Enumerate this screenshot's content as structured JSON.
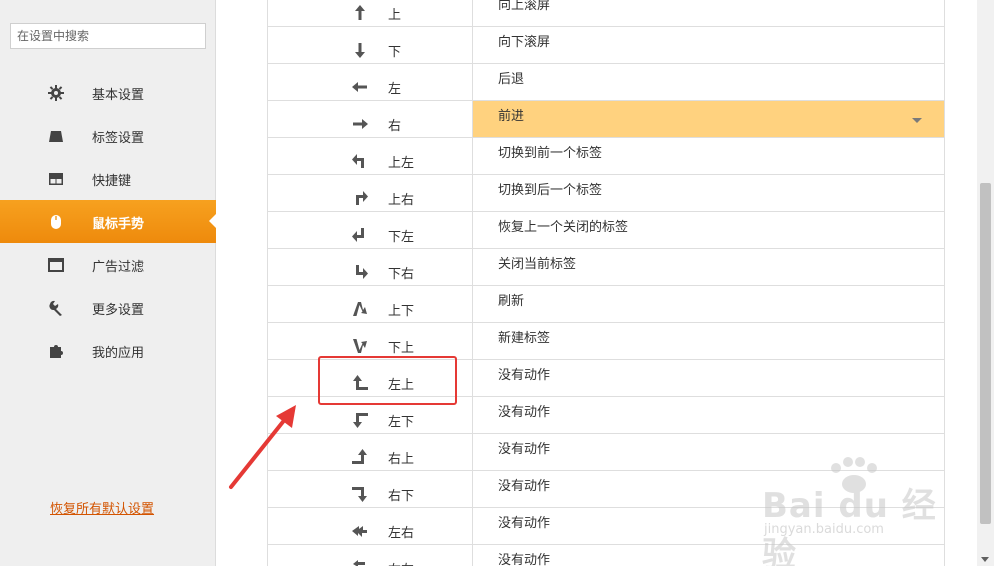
{
  "sidebar": {
    "search_placeholder": "在设置中搜索",
    "items": [
      {
        "label": "基本设置",
        "icon": "gear-icon"
      },
      {
        "label": "标签设置",
        "icon": "tab-icon"
      },
      {
        "label": "快捷键",
        "icon": "keyboard-icon"
      },
      {
        "label": "鼠标手势",
        "icon": "mouse-icon",
        "active": true
      },
      {
        "label": "广告过滤",
        "icon": "window-icon"
      },
      {
        "label": "更多设置",
        "icon": "wrench-icon"
      },
      {
        "label": "我的应用",
        "icon": "puzzle-icon"
      }
    ],
    "restore_label": "恢复所有默认设置"
  },
  "gestures": [
    {
      "label": "上",
      "icon": "arrow-up-icon",
      "action": "向上滚屏"
    },
    {
      "label": "下",
      "icon": "arrow-down-icon",
      "action": "向下滚屏"
    },
    {
      "label": "左",
      "icon": "arrow-left-icon",
      "action": "后退"
    },
    {
      "label": "右",
      "icon": "arrow-right-icon",
      "action": "前进",
      "selected": true
    },
    {
      "label": "上左",
      "icon": "up-left-icon",
      "action": "切换到前一个标签"
    },
    {
      "label": "上右",
      "icon": "up-right-icon",
      "action": "切换到后一个标签"
    },
    {
      "label": "下左",
      "icon": "down-left-icon",
      "action": "恢复上一个关闭的标签"
    },
    {
      "label": "下右",
      "icon": "down-right-icon",
      "action": "关闭当前标签"
    },
    {
      "label": "上下",
      "icon": "up-down-icon",
      "action": "刷新"
    },
    {
      "label": "下上",
      "icon": "down-up-icon",
      "action": "新建标签"
    },
    {
      "label": "左上",
      "icon": "left-up-icon",
      "action": "没有动作"
    },
    {
      "label": "左下",
      "icon": "left-down-icon",
      "action": "没有动作"
    },
    {
      "label": "右上",
      "icon": "right-up-icon",
      "action": "没有动作"
    },
    {
      "label": "右下",
      "icon": "right-down-icon",
      "action": "没有动作"
    },
    {
      "label": "左右",
      "icon": "left-right-icon",
      "action": "没有动作"
    },
    {
      "label": "右左",
      "icon": "right-left-icon",
      "action": "没有动作"
    }
  ],
  "colors": {
    "accent": "#f39a18",
    "selected_row": "#ffd27f",
    "annotation": "#e53935"
  },
  "watermark": {
    "brand": "Bai du 经验",
    "sub": "jingyan.baidu.com"
  }
}
